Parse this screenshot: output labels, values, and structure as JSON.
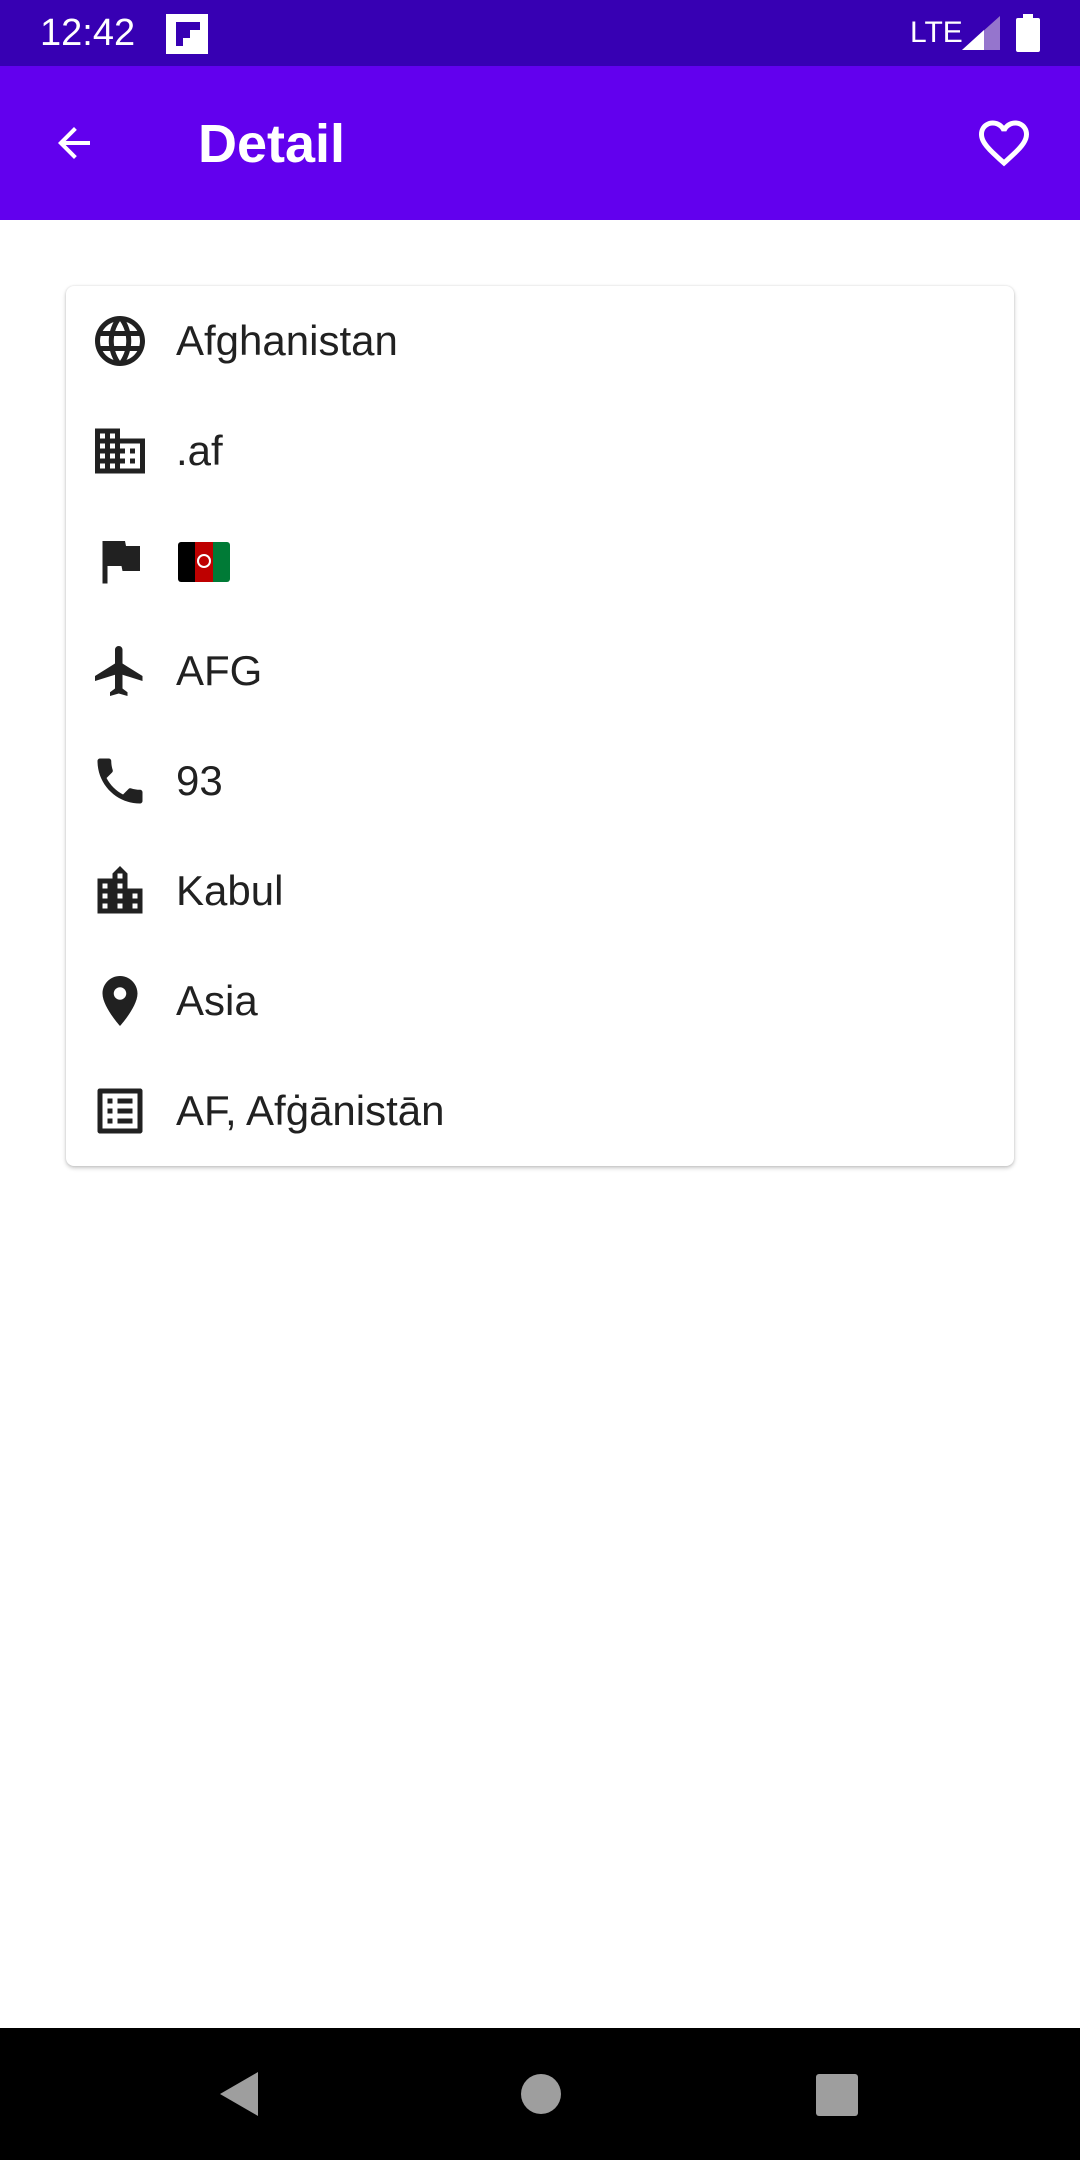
{
  "status_bar": {
    "time": "12:42",
    "network": "LTE",
    "app_icon": "flipboard-icon"
  },
  "app_bar": {
    "title": "Detail",
    "background": "#6200ee",
    "back_icon": "arrow-back-icon",
    "favorite_icon": "heart-outline-icon"
  },
  "details": [
    {
      "icon": "globe-icon",
      "text": "Afghanistan"
    },
    {
      "icon": "domain-icon",
      "text": ".af"
    },
    {
      "icon": "flag-icon",
      "text": "🇦🇫",
      "flag_colors": [
        "#000000",
        "#be0000",
        "#007a36"
      ]
    },
    {
      "icon": "airplane-icon",
      "text": "AFG"
    },
    {
      "icon": "phone-icon",
      "text": "93"
    },
    {
      "icon": "city-icon",
      "text": "Kabul"
    },
    {
      "icon": "location-pin-icon",
      "text": "Asia"
    },
    {
      "icon": "list-icon",
      "text": "AF, Afġānistān"
    }
  ],
  "nav_bar": {
    "back": "nav-back-icon",
    "home": "nav-home-icon",
    "recents": "nav-recents-icon"
  }
}
